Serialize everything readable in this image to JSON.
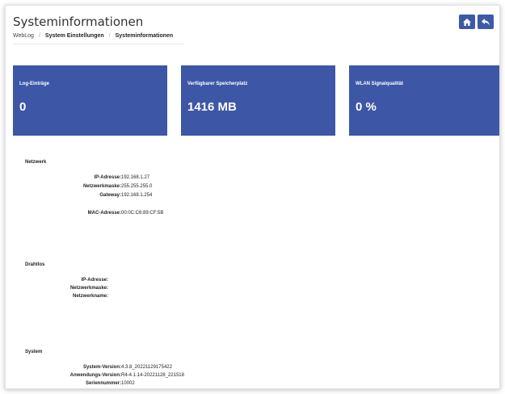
{
  "header": {
    "title": "Systeminformationen",
    "breadcrumb": [
      "WebLog",
      "System Einstellungen",
      "Systeminformationen"
    ],
    "buttons": [
      {
        "name": "home",
        "icon": "home-icon"
      },
      {
        "name": "back",
        "icon": "reply-icon"
      }
    ]
  },
  "cards": [
    {
      "label": "Log-Einträge",
      "value": "0"
    },
    {
      "label": "Verfügbarer Speicherplatz",
      "value": "1416 MB"
    },
    {
      "label": "WLAN Signalqualität",
      "value": "0 %"
    }
  ],
  "sections": {
    "netzwerk": {
      "title": "Netzwerk",
      "rows": [
        {
          "label": "IP-Adresse:",
          "value": "192.168.1.27"
        },
        {
          "label": "Netzwerkmaske:",
          "value": "255.255.255.0"
        },
        {
          "label": "Gateway:",
          "value": "192.168.1.254"
        },
        {
          "label": "MAC-Adresse:",
          "value": "00:0C:C6:89:CF:5B"
        }
      ]
    },
    "drahtlos": {
      "title": "Drahtlos",
      "rows": [
        {
          "label": "IP-Adresse:",
          "value": ""
        },
        {
          "label": "Netzwerkmaske:",
          "value": ""
        },
        {
          "label": "Netzwerkname:",
          "value": ""
        }
      ]
    },
    "system": {
      "title": "System",
      "rows": [
        {
          "label": "System-Version:",
          "value": "4.3.8_20221129175422"
        },
        {
          "label": "Anwendungs-Version:",
          "value": "R4-4.1.14-20221128_221518"
        },
        {
          "label": "Seriennummer:",
          "value": "10002"
        }
      ]
    }
  },
  "colors": {
    "accent": "#3d57a6",
    "button": "#3d5aa8"
  }
}
